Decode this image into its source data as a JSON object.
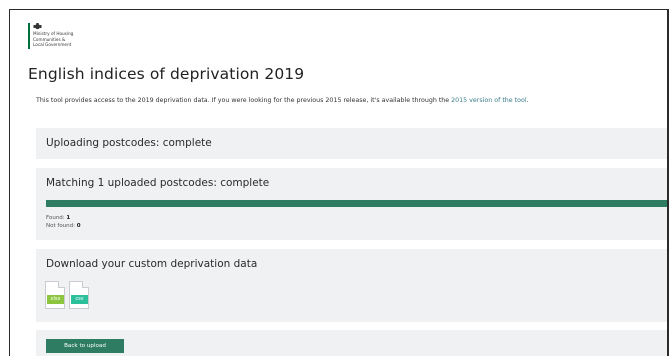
{
  "header": {
    "logo_lines": [
      "Ministry of Housing",
      "Communities &",
      "Local Government"
    ]
  },
  "page": {
    "title": "English indices of deprivation 2019",
    "intro_text": "This tool provides access to the 2019 deprivation data. If you were looking for the previous 2015 release, it's available through the ",
    "intro_link": "2015 version of the tool",
    "intro_end": "."
  },
  "upload_panel": {
    "heading": "Uploading postcodes: complete"
  },
  "match_panel": {
    "heading": "Matching 1 uploaded postcodes: complete",
    "progress_percent": 100,
    "found_label": "Found: ",
    "found_value": "1",
    "not_found_label": "Not found: ",
    "not_found_value": "0"
  },
  "download_panel": {
    "heading": "Download your custom deprivation data",
    "files": [
      {
        "label": "xlsx",
        "icon": "xlsx-file-icon",
        "color": "#8cc63f"
      },
      {
        "label": "csv",
        "icon": "csv-file-icon",
        "color": "#2cbf9b"
      }
    ]
  },
  "back_panel": {
    "button_label": "Back to upload"
  },
  "colors": {
    "accent": "#2e7d63",
    "panel_bg": "#f0f1f3",
    "link": "#3a7c8a",
    "logo_bar": "#00703c"
  }
}
